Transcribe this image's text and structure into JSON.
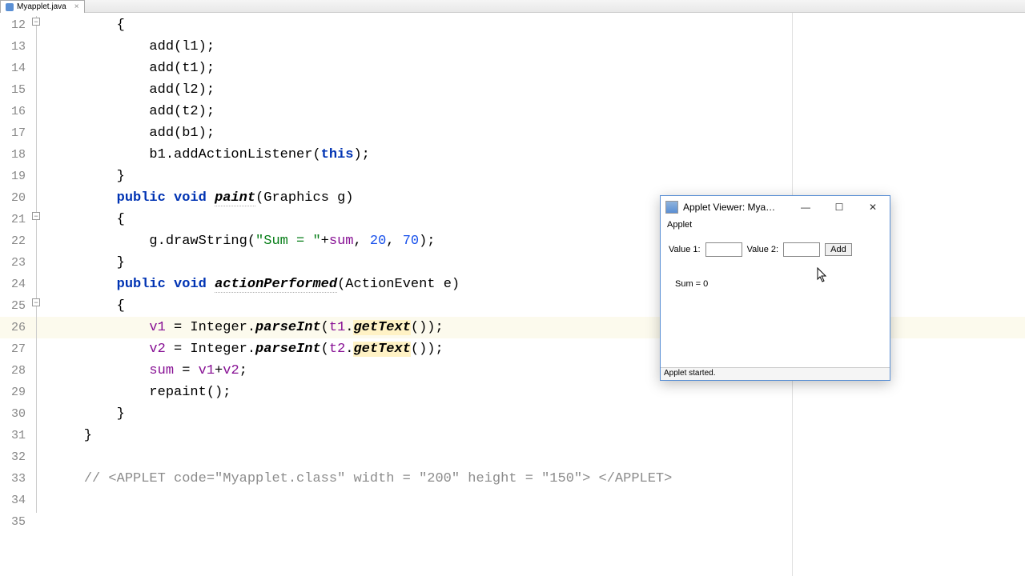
{
  "tab": {
    "filename": "Myapplet.java"
  },
  "gutter": {
    "start": 12,
    "end": 35,
    "override_lines": [
      21,
      25
    ]
  },
  "code_lines": [
    {
      "n": 12,
      "html": "        {"
    },
    {
      "n": 13,
      "html": "            add(l1);"
    },
    {
      "n": 14,
      "html": "            add(t1);"
    },
    {
      "n": 15,
      "html": "            add(l2);"
    },
    {
      "n": 16,
      "html": "            add(t2);"
    },
    {
      "n": 17,
      "html": "            add(b1);"
    },
    {
      "n": 18,
      "html": "            b1.addActionListener(<span class='kw'>this</span>);"
    },
    {
      "n": 19,
      "html": "        }"
    },
    {
      "n": 20,
      "html": "        <span class='kw'>public</span> <span class='kw'>void</span> <span class='mthu'>paint</span>(Graphics g)"
    },
    {
      "n": 21,
      "html": "        {"
    },
    {
      "n": 22,
      "html": "            g.drawString(<span class='str'>\"Sum = \"</span>+<span class='pf'>sum</span>, <span class='num'>20</span>, <span class='num'>70</span>);"
    },
    {
      "n": 23,
      "html": "        }"
    },
    {
      "n": 24,
      "html": "        <span class='kw'>public</span> <span class='kw'>void</span> <span class='mthu'>actionPerformed</span>(ActionEvent e)"
    },
    {
      "n": 25,
      "html": "        {"
    },
    {
      "n": 26,
      "html": "            <span class='pf'>v1</span> = Integer.<span class='mth'>parseInt</span>(<span class='pf'>t1</span>.<span class='hlm'>getText</span>());",
      "hl": true
    },
    {
      "n": 27,
      "html": "            <span class='pf'>v2</span> = Integer.<span class='mth'>parseInt</span>(<span class='pf'>t2</span>.<span class='hlm'>getText</span>());"
    },
    {
      "n": 28,
      "html": "            <span class='pf'>sum</span> = <span class='pf'>v1</span>+<span class='pf'>v2</span>;"
    },
    {
      "n": 29,
      "html": "            repaint();"
    },
    {
      "n": 30,
      "html": "        }"
    },
    {
      "n": 31,
      "html": "    }"
    },
    {
      "n": 32,
      "html": ""
    },
    {
      "n": 33,
      "html": "    <span class='cmt'>// &lt;APPLET code=\"Myapplet.class\" width = \"200\" height = \"150\"&gt; &lt;/APPLET&gt;</span>"
    },
    {
      "n": 34,
      "html": ""
    }
  ],
  "fold_markers": [
    {
      "line": 12,
      "offset": 0
    },
    {
      "line": 21,
      "offset": 9
    },
    {
      "line": 25,
      "offset": 13
    }
  ],
  "applet": {
    "title": "Applet Viewer: Mya…",
    "menu": "Applet",
    "label1": "Value 1:",
    "label2": "Value 2:",
    "value1": "",
    "value2": "",
    "add_button": "Add",
    "sum": "Sum = 0",
    "status": "Applet started."
  }
}
